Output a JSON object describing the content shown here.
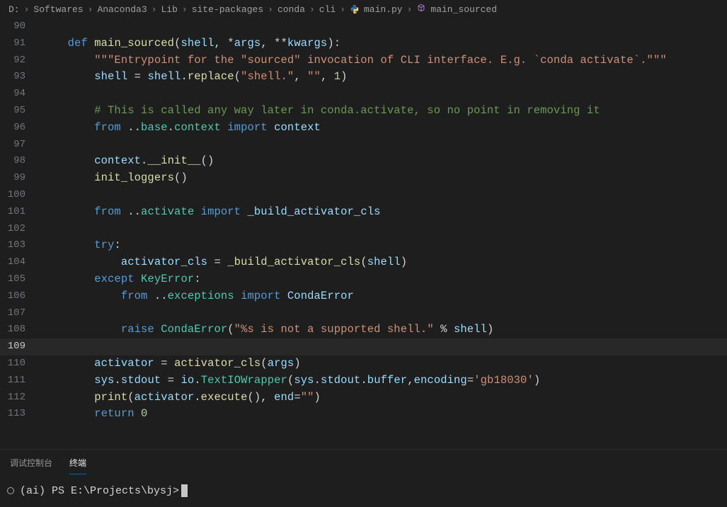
{
  "breadcrumb": {
    "p0": "D:",
    "p1": "Softwares",
    "p2": "Anaconda3",
    "p3": "Lib",
    "p4": "site-packages",
    "p5": "conda",
    "p6": "cli",
    "file": "main.py",
    "symbol": "main_sourced"
  },
  "lines": {
    "n90": "90",
    "n91": "91",
    "n92": "92",
    "n93": "93",
    "n94": "94",
    "n95": "95",
    "n96": "96",
    "n97": "97",
    "n98": "98",
    "n99": "99",
    "n100": "100",
    "n101": "101",
    "n102": "102",
    "n103": "103",
    "n104": "104",
    "n105": "105",
    "n106": "106",
    "n107": "107",
    "n108": "108",
    "n109": "109",
    "n110": "110",
    "n111": "111",
    "n112": "112",
    "n113": "113"
  },
  "c91": {
    "def": "def",
    "fn": "main_sourced",
    "lp": "(",
    "shell": "shell",
    "c1": ", *",
    "args": "args",
    "c2": ", **",
    "kw": "kwargs",
    "rp": "):"
  },
  "c92": {
    "doc": "\"\"\"Entrypoint for the \"sourced\" invocation of CLI interface. E.g. `conda activate`.\"\"\""
  },
  "c93": {
    "v": "shell",
    "eq": " = ",
    "v2": "shell",
    "dot": ".",
    "fn": "replace",
    "lp": "(",
    "s1": "\"shell.\"",
    "c": ", ",
    "s2": "\"\"",
    "c2": ", ",
    "n": "1",
    "rp": ")"
  },
  "c95": {
    "cmt": "# This is called any way later in conda.activate, so no point in removing it"
  },
  "c96": {
    "frm": "from",
    "dots": " ..",
    "mod1": "base",
    "dot": ".",
    "mod2": "context",
    "sp": " ",
    "imp": "import",
    "sp2": " ",
    "name": "context"
  },
  "c98": {
    "v": "context",
    "dot": ".",
    "fn": "__init__",
    "p": "()"
  },
  "c99": {
    "fn": "init_loggers",
    "p": "()"
  },
  "c101": {
    "frm": "from",
    "dots": " ..",
    "mod": "activate",
    "sp": " ",
    "imp": "import",
    "sp2": " ",
    "name": "_build_activator_cls"
  },
  "c103": {
    "try": "try",
    "colon": ":"
  },
  "c104": {
    "v": "activator_cls",
    "eq": " = ",
    "fn": "_build_activator_cls",
    "lp": "(",
    "a": "shell",
    "rp": ")"
  },
  "c105": {
    "exc": "except",
    "sp": " ",
    "cls": "KeyError",
    "colon": ":"
  },
  "c106": {
    "frm": "from",
    "dots": " ..",
    "mod": "exceptions",
    "sp": " ",
    "imp": "import",
    "sp2": " ",
    "name": "CondaError"
  },
  "c108": {
    "raise": "raise",
    "sp": " ",
    "cls": "CondaError",
    "lp": "(",
    "s": "\"%s is not a supported shell.\"",
    "pct": " % ",
    "v": "shell",
    "rp": ")"
  },
  "c110": {
    "v": "activator",
    "eq": " = ",
    "fn": "activator_cls",
    "lp": "(",
    "a": "args",
    "rp": ")"
  },
  "c111": {
    "v1": "sys",
    "d1": ".",
    "v2": "stdout",
    "eq": " = ",
    "v3": "io",
    "d2": ".",
    "cls": "TextIOWrapper",
    "lp": "(",
    "a1": "sys",
    "d3": ".",
    "a2": "stdout",
    "d4": ".",
    "a3": "buffer",
    "c": ",",
    "k": "encoding",
    "eq2": "=",
    "s": "'gb18030'",
    "rp": ")"
  },
  "c112": {
    "fn": "print",
    "lp": "(",
    "v": "activator",
    "d": ".",
    "fn2": "execute",
    "p": "()",
    "c": ", ",
    "k": "end",
    "eq": "=",
    "s": "\"\"",
    "rp": ")"
  },
  "c113": {
    "ret": "return",
    "sp": " ",
    "n": "0"
  },
  "tabs": {
    "debug": "调试控制台",
    "term": "终端"
  },
  "terminal": {
    "prompt": "(ai) PS E:\\Projects\\bysj> "
  }
}
